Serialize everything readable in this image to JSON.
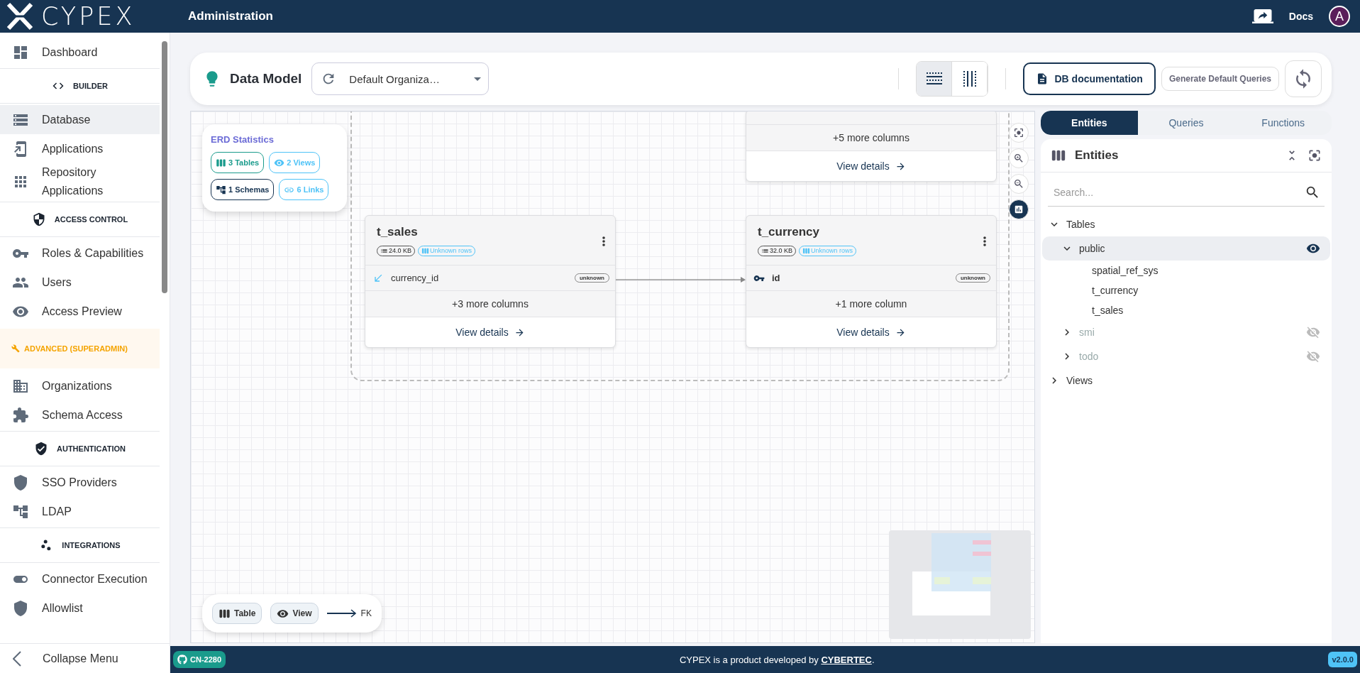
{
  "header": {
    "logo": "CYPEX",
    "title": "Administration",
    "docs": "Docs",
    "avatar": "A"
  },
  "sidebar": {
    "items": [
      {
        "kind": "item",
        "label": "Dashboard",
        "selected": false
      },
      {
        "kind": "section",
        "label": "BUILDER"
      },
      {
        "kind": "item",
        "label": "Database",
        "selected": true
      },
      {
        "kind": "item",
        "label": "Applications",
        "selected": false
      },
      {
        "kind": "item",
        "label": "Repository Applications",
        "selected": false
      },
      {
        "kind": "section",
        "label": "ACCESS CONTROL"
      },
      {
        "kind": "item",
        "label": "Roles & Capabilities",
        "selected": false
      },
      {
        "kind": "item",
        "label": "Users",
        "selected": false
      },
      {
        "kind": "item",
        "label": "Access Preview",
        "selected": false
      },
      {
        "kind": "advanced",
        "label": "ADVANCED (SUPERADMIN)"
      },
      {
        "kind": "item",
        "label": "Organizations",
        "selected": false
      },
      {
        "kind": "item",
        "label": "Schema Access",
        "selected": false
      },
      {
        "kind": "section",
        "label": "AUTHENTICATION"
      },
      {
        "kind": "item",
        "label": "SSO Providers",
        "selected": false
      },
      {
        "kind": "item",
        "label": "LDAP",
        "selected": false
      },
      {
        "kind": "section",
        "label": "INTEGRATIONS"
      },
      {
        "kind": "item",
        "label": "Connector Execution",
        "selected": false
      },
      {
        "kind": "item",
        "label": "Allowlist",
        "selected": false
      }
    ],
    "collapse": "Collapse Menu"
  },
  "toolbar": {
    "title": "Data Model",
    "organization": "Default Organiza…",
    "layouts": [
      {
        "selected": true
      },
      {
        "selected": false
      }
    ],
    "doc_button": "DB documentation",
    "generate_button": "Generate Default Queries"
  },
  "canvas": {
    "stats": {
      "title": "ERD Statistics",
      "badges": [
        {
          "label": "3 Tables",
          "color": "#1a9b8c"
        },
        {
          "label": "2 Views",
          "color": "#4fc3f7"
        },
        {
          "label": "1 Schemas",
          "color": "#173452"
        },
        {
          "label": "6 Links",
          "color": "#4fc3f7"
        }
      ]
    },
    "tables": [
      {
        "more": "+5 more columns",
        "details": "View details"
      },
      {
        "name": "t_sales",
        "size": "24.0 KB",
        "rows": "Unknown rows",
        "columns": [
          {
            "name": "currency_id",
            "kind": "fk",
            "type": "unknown"
          }
        ],
        "more": "+3 more columns",
        "details": "View details"
      },
      {
        "name": "t_currency",
        "size": "32.0 KB",
        "rows": "Unknown rows",
        "columns": [
          {
            "name": "id",
            "kind": "pk",
            "type": "unknown"
          }
        ],
        "more": "+1 more column",
        "details": "View details"
      }
    ],
    "legend": [
      {
        "kind": "table",
        "label": "Table"
      },
      {
        "kind": "view",
        "label": "View"
      },
      {
        "kind": "fk",
        "label": "FK"
      }
    ]
  },
  "panel": {
    "tabs": [
      {
        "label": "Entities",
        "selected": true
      },
      {
        "label": "Queries",
        "selected": false
      },
      {
        "label": "Functions",
        "selected": false
      }
    ],
    "title": "Entities",
    "search": {
      "placeholder": "Search..."
    },
    "tree": [
      {
        "label": "Tables",
        "expanded": true,
        "children": [
          {
            "label": "public",
            "expanded": true,
            "selected": true,
            "visible": true,
            "children": [
              {
                "label": "spatial_ref_sys"
              },
              {
                "label": "t_currency"
              },
              {
                "label": "t_sales"
              }
            ]
          },
          {
            "label": "smi",
            "expanded": false,
            "selected": false,
            "visible": false
          },
          {
            "label": "todo",
            "expanded": false,
            "selected": false,
            "visible": false
          }
        ]
      },
      {
        "label": "Views",
        "expanded": false
      }
    ]
  },
  "footer": {
    "branch": "CN-2280",
    "text": "CYPEX is a product developed by",
    "link": "CYBERTEC",
    "end": ".",
    "version": "v2.0.0"
  }
}
